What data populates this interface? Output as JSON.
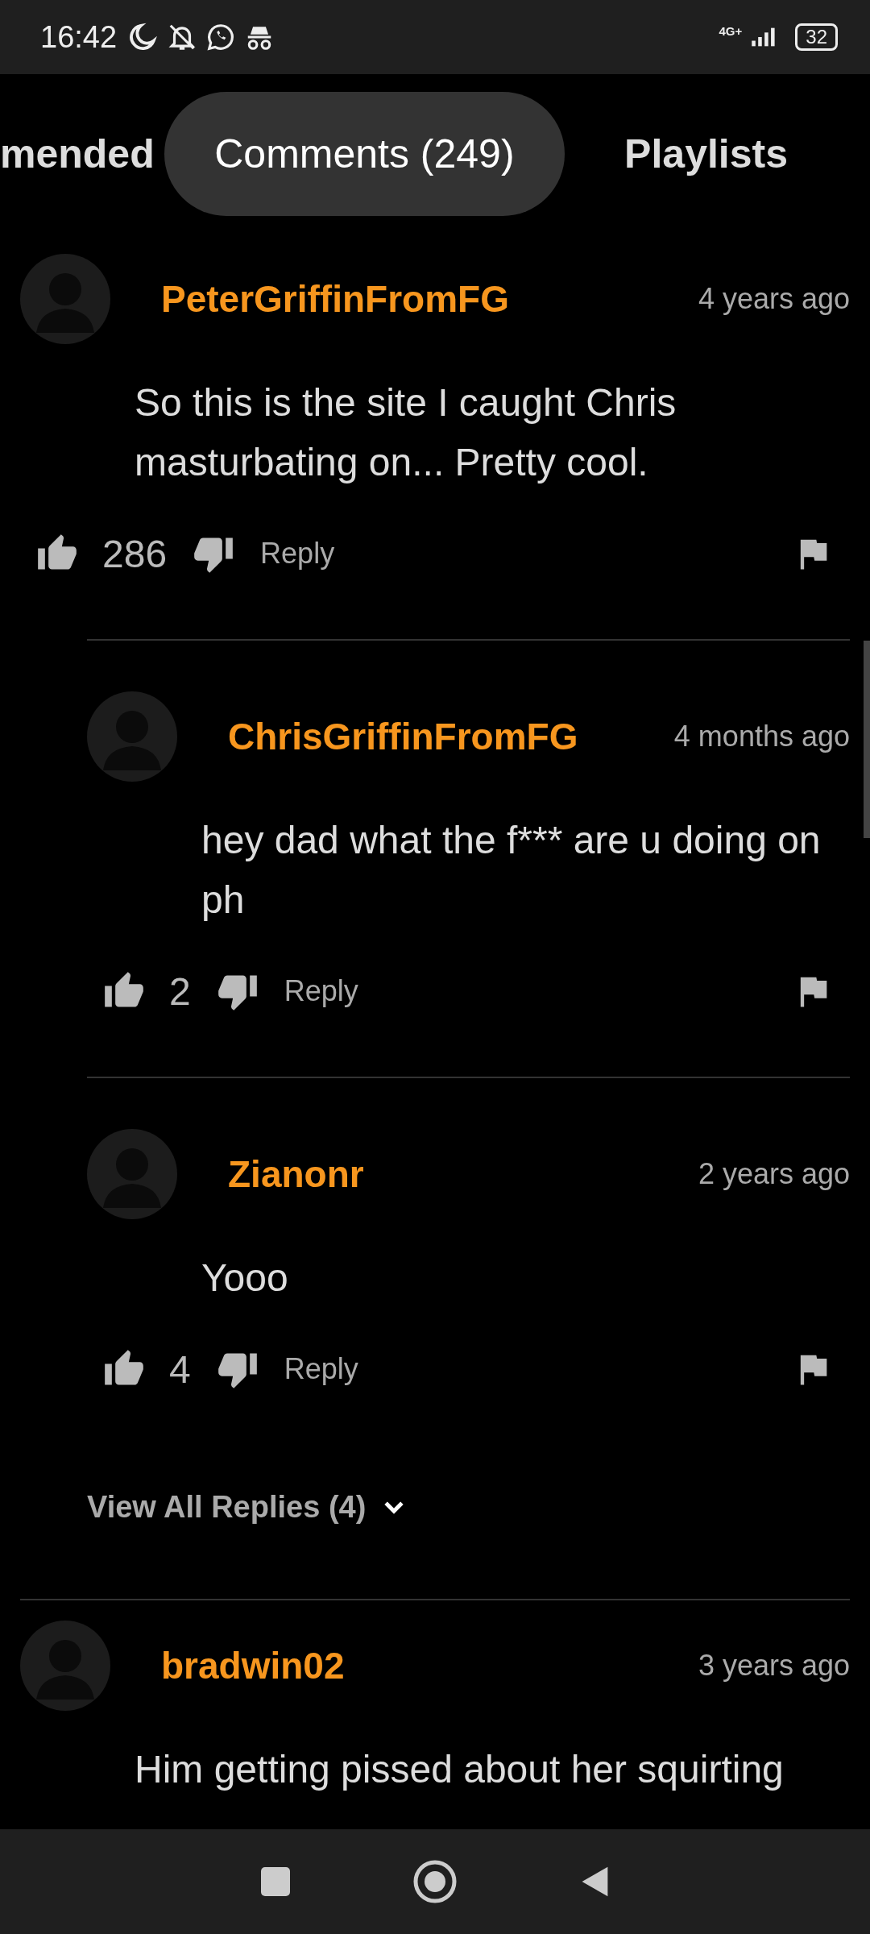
{
  "status_bar": {
    "time": "16:42",
    "network": "4G+",
    "battery": "32"
  },
  "tabs": [
    {
      "label": "mended",
      "selected": false
    },
    {
      "label": "Comments (249)",
      "selected": true
    },
    {
      "label": "Playlists",
      "selected": false
    }
  ],
  "comments": [
    {
      "username": "PeterGriffinFromFG",
      "time": "4 years ago",
      "text": "So this is the site I caught Chris masturbating on... Pretty cool.",
      "likes": "286",
      "reply_label": "Reply",
      "replies": [
        {
          "username": "ChrisGriffinFromFG",
          "time": "4 months ago",
          "text": "hey dad what the f*** are u doing on ph",
          "likes": "2",
          "reply_label": "Reply"
        },
        {
          "username": "Zianonr",
          "time": "2 years ago",
          "text": "Yooo",
          "likes": "4",
          "reply_label": "Reply"
        }
      ],
      "view_replies": "View All Replies (4)"
    },
    {
      "username": "bradwin02",
      "time": "3 years ago",
      "text": "Him getting pissed about her squirting"
    }
  ]
}
